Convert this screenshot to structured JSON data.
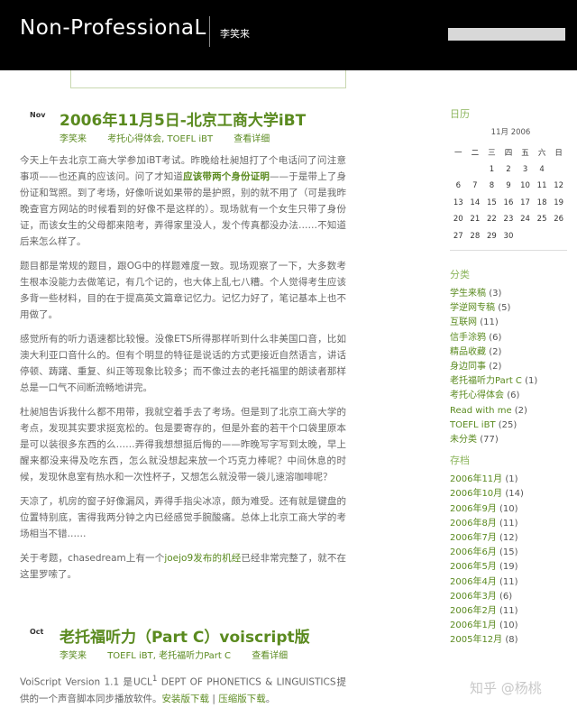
{
  "header": {
    "site_title": "Non-ProfessionaL",
    "tagline": "李笑来"
  },
  "posts": [
    {
      "month": "Nov",
      "title": "2006年11月5日-北京工商大学iBT",
      "author": "李笑来",
      "categories": "考托心得体会, TOEFL iBT",
      "details": "查看详细",
      "paragraphs": [
        {
          "pre": "今天上午去北京工商大学参加iBT考试。昨晚给杜昶旭打了个电话问了问注意事项——也还真的应该问。问了才知道",
          "highlight": "应该带两个身份证明",
          "post": "——于是带上了身份证和驾照。到了考场，好像听说如果带的是护照，别的就不用了（可是我昨晚查官方网站的时候看到的好像不是这样的）。现场就有一个女生只带了身份证，而该女生的父母都来陪考，弄得家里没人，发个传真都没办法……不知道后来怎么样了。"
        },
        {
          "text": "题目都是常规的题目，跟OG中的样题难度一致。现场观察了一下，大多数考生根本没能力去做笔记，有几个记的，也大体上乱七八糟。个人觉得考生应该多背一些材料，目的在于提高英文篇章记忆力。记忆力好了，笔记基本上也不用做了。"
        },
        {
          "text": "感觉所有的听力语速都比较慢。没像ETS所得那样听到什么非美国口音，比如澳大利亚口音什么的。但有个明显的特征是说话的方式更接近自然语言，讲话停顿、踌躇、重复、纠正等现象比较多；而不像过去的老托福里的朗读者那样总是一口气不间断流畅地讲完。"
        },
        {
          "text": "杜昶旭告诉我什么都不用带，我就空着手去了考场。但是到了北京工商大学的考点，发现其实要求挺宽松的。包是要寄存的，但是外套的若干个口袋里原本是可以装很多东西的么……弄得我想想挺后悔的——昨晚写字写到太晚，早上醒来都没来得及吃东西，怎么就没想起来放一个巧克力棒呢？中间休息的时候，发现休息室有热水和一次性杯子，又想怎么就没带一袋儿速溶咖啡呢？"
        },
        {
          "text": "天凉了，机房的窗子好像漏风，弄得手指尖冰凉，颇为难受。还有就是键盘的位置特别底，害得我两分钟之内已经感觉手腕酸痛。总体上北京工商大学的考场相当不错……"
        },
        {
          "pre": "关于考题，chasedream上有一个",
          "highlight": "joejo9发布的机经",
          "post": "已经非常完整了，就不在这里罗嗦了。"
        }
      ]
    },
    {
      "month": "Oct",
      "title": "老托福听力（Part C）voiscript版",
      "author": "李笑来",
      "categories": "TOEFL iBT, 老托福听力Part C",
      "details": "查看详细",
      "intro_pre": "VoiScript Version 1.1 是UCL",
      "intro_sup": "1",
      "intro_post": " DEPT OF PHONETICS & LINGUISTICS提供的一个声音脚本同步播放软件。",
      "link1": "安装版下载",
      "sep": " | ",
      "link2": "压缩版下载",
      "end": "。"
    }
  ],
  "sidebar": {
    "calendar_heading": "日历",
    "calendar_caption": "11月 2006",
    "weekdays": [
      "一",
      "二",
      "三",
      "四",
      "五",
      "六",
      "日"
    ],
    "weeks": [
      [
        "",
        "",
        "1",
        "2",
        "3",
        "4",
        ""
      ],
      [
        "6",
        "7",
        "8",
        "9",
        "10",
        "11",
        "12"
      ],
      [
        "13",
        "14",
        "15",
        "16",
        "17",
        "18",
        "19"
      ],
      [
        "20",
        "21",
        "22",
        "23",
        "24",
        "25",
        "26"
      ],
      [
        "27",
        "28",
        "29",
        "30",
        "",
        "",
        ""
      ]
    ],
    "categories_heading": "分类",
    "categories": [
      {
        "name": "学生来稿",
        "count": "(3)"
      },
      {
        "name": "学逆网专稿",
        "count": "(5)"
      },
      {
        "name": "互联网",
        "count": "(11)"
      },
      {
        "name": "信手涂鸦",
        "count": "(6)"
      },
      {
        "name": "精品收藏",
        "count": "(2)"
      },
      {
        "name": "身边同事",
        "count": "(2)"
      },
      {
        "name": "老托福听力Part C",
        "count": "(1)"
      },
      {
        "name": "考托心得体会",
        "count": "(6)"
      },
      {
        "name": "Read with me",
        "count": "(2)"
      },
      {
        "name": "TOEFL iBT",
        "count": "(25)"
      },
      {
        "name": "未分类",
        "count": "(77)"
      }
    ],
    "archives_heading": "存档",
    "archives": [
      {
        "name": "2006年11月",
        "count": "(1)"
      },
      {
        "name": "2006年10月",
        "count": "(14)"
      },
      {
        "name": "2006年9月",
        "count": "(10)"
      },
      {
        "name": "2006年8月",
        "count": "(11)"
      },
      {
        "name": "2006年7月",
        "count": "(12)"
      },
      {
        "name": "2006年6月",
        "count": "(15)"
      },
      {
        "name": "2006年5月",
        "count": "(19)"
      },
      {
        "name": "2006年4月",
        "count": "(11)"
      },
      {
        "name": "2006年3月",
        "count": "(6)"
      },
      {
        "name": "2006年2月",
        "count": "(11)"
      },
      {
        "name": "2006年1月",
        "count": "(10)"
      },
      {
        "name": "2005年12月",
        "count": "(8)"
      }
    ]
  },
  "watermark": "知乎 @杨桃",
  "colors": {
    "accent": "#5a8a1f",
    "heading": "#8cb55c",
    "header_bg": "#000000"
  }
}
